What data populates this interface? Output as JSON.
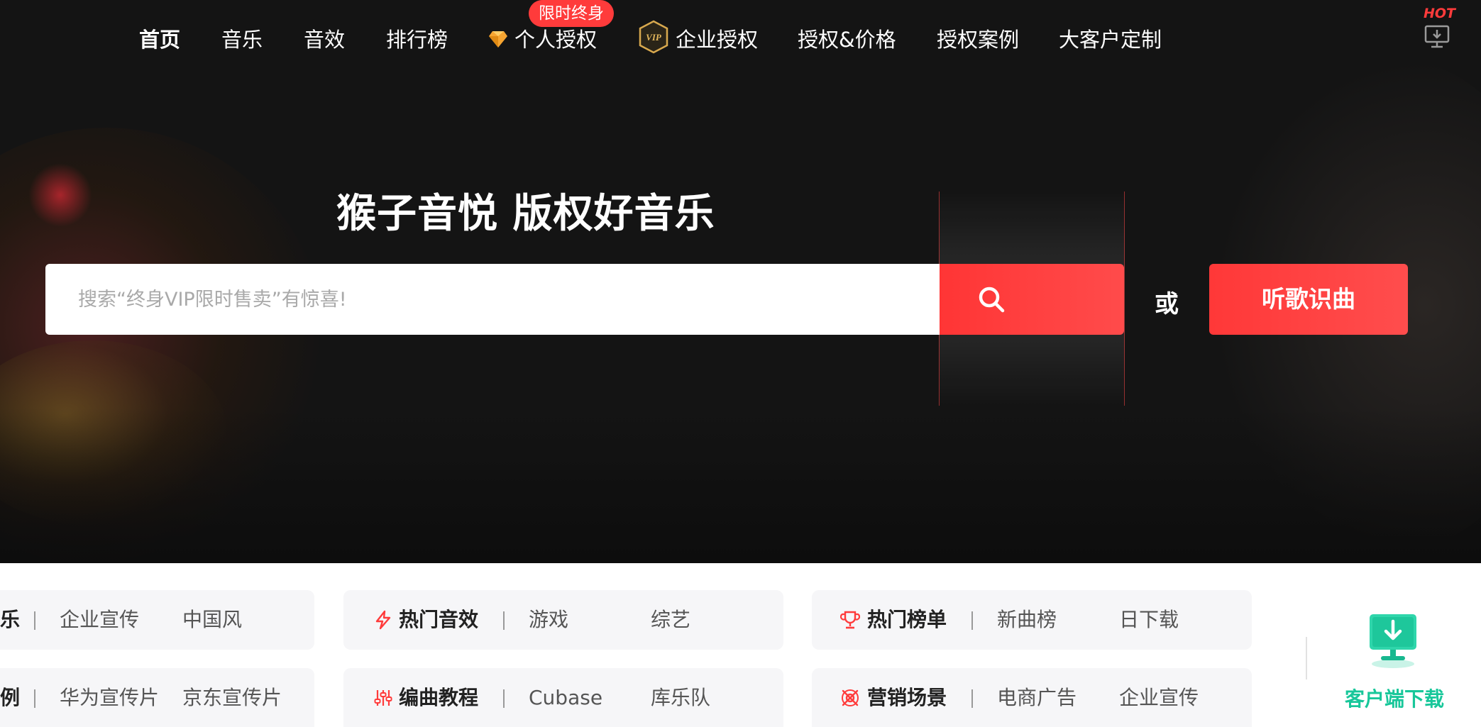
{
  "nav": {
    "items": [
      {
        "label": "首页"
      },
      {
        "label": "音乐"
      },
      {
        "label": "音效"
      },
      {
        "label": "排行榜"
      },
      {
        "label": "个人授权"
      },
      {
        "label": "企业授权"
      },
      {
        "label": "授权&价格"
      },
      {
        "label": "授权案例"
      },
      {
        "label": "大客户定制"
      }
    ],
    "badge": "限时终身",
    "vip_icon_text": "VIP",
    "hot_label": "HOT",
    "icons": {
      "personal": "diamond-icon",
      "enterprise": "vip-badge-icon",
      "client": "monitor-download-icon"
    }
  },
  "hero": {
    "title": "猴子音悦 版权好音乐",
    "search_placeholder": "搜索“终身VIP限时售卖”有惊喜!",
    "or_text": "或",
    "identify_button": "听歌识曲"
  },
  "categories": {
    "row1": [
      {
        "title": "乐",
        "links": [
          "企业宣传",
          "中国风"
        ]
      },
      {
        "title": "热门音效",
        "icon": "lightning-icon",
        "links": [
          "游戏",
          "综艺"
        ]
      },
      {
        "title": "热门榜单",
        "icon": "trophy-icon",
        "links": [
          "新曲榜",
          "日下载"
        ]
      }
    ],
    "row2": [
      {
        "title": "例",
        "links": [
          "华为宣传片",
          "京东宣传片"
        ]
      },
      {
        "title": "编曲教程",
        "icon": "mixer-icon",
        "links": [
          "Cubase",
          "库乐队"
        ]
      },
      {
        "title": "营销场景",
        "icon": "scene-icon",
        "links": [
          "电商广告",
          "企业宣传"
        ]
      }
    ]
  },
  "download": {
    "label": "客户端下载"
  },
  "colors": {
    "accent": "#ff3b3b",
    "green": "#18c79a",
    "dark": "#141414",
    "card_bg": "#f6f6f8"
  }
}
